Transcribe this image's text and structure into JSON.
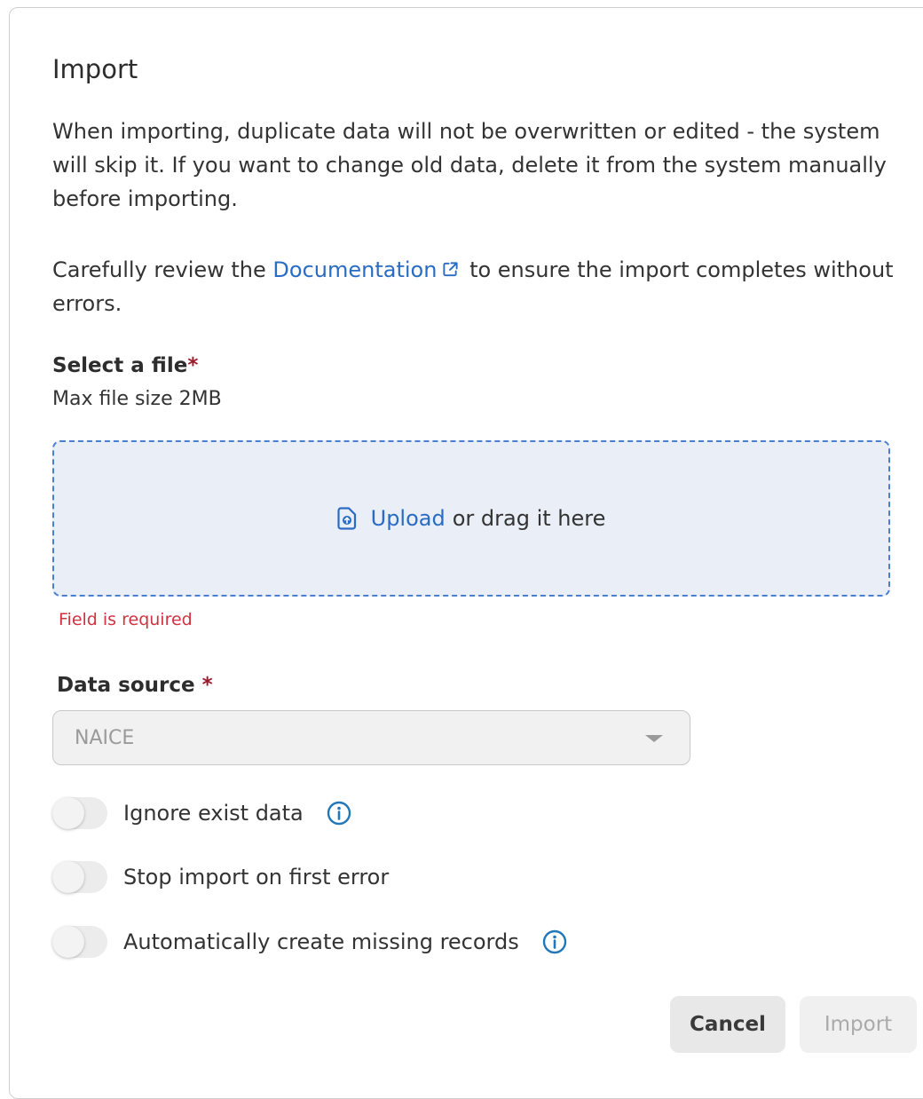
{
  "dialog": {
    "title": "Import",
    "intro": "When importing, duplicate data will not be overwritten or edited - the system will skip it. If you want to change old data, delete it from the system manually before importing.",
    "review_prefix": "Carefully review the ",
    "documentation_link": "Documentation",
    "review_suffix": " to ensure the import completes without errors."
  },
  "file": {
    "label": "Select a file",
    "required_mark": "*",
    "hint": "Max file size 2MB",
    "upload_link": "Upload",
    "drag_text": "or drag it here",
    "error": "Field is required"
  },
  "data_source": {
    "label": "Data source",
    "required_mark": "*",
    "selected": "NAICE"
  },
  "toggles": [
    {
      "label": "Ignore exist data",
      "on": false,
      "has_info": true
    },
    {
      "label": "Stop import on first error",
      "on": false,
      "has_info": false
    },
    {
      "label": "Automatically create missing records",
      "on": false,
      "has_info": true
    }
  ],
  "buttons": {
    "cancel": "Cancel",
    "import": "Import"
  },
  "colors": {
    "accent": "#2a6cc3",
    "error": "#d0323f",
    "required": "#9c1a2e",
    "dropzone_bg": "#e9eef7"
  },
  "icons": {
    "external_link": "external-link-icon",
    "upload": "upload-file-icon",
    "info": "info-icon",
    "select_caret": "chevron-down-icon"
  }
}
